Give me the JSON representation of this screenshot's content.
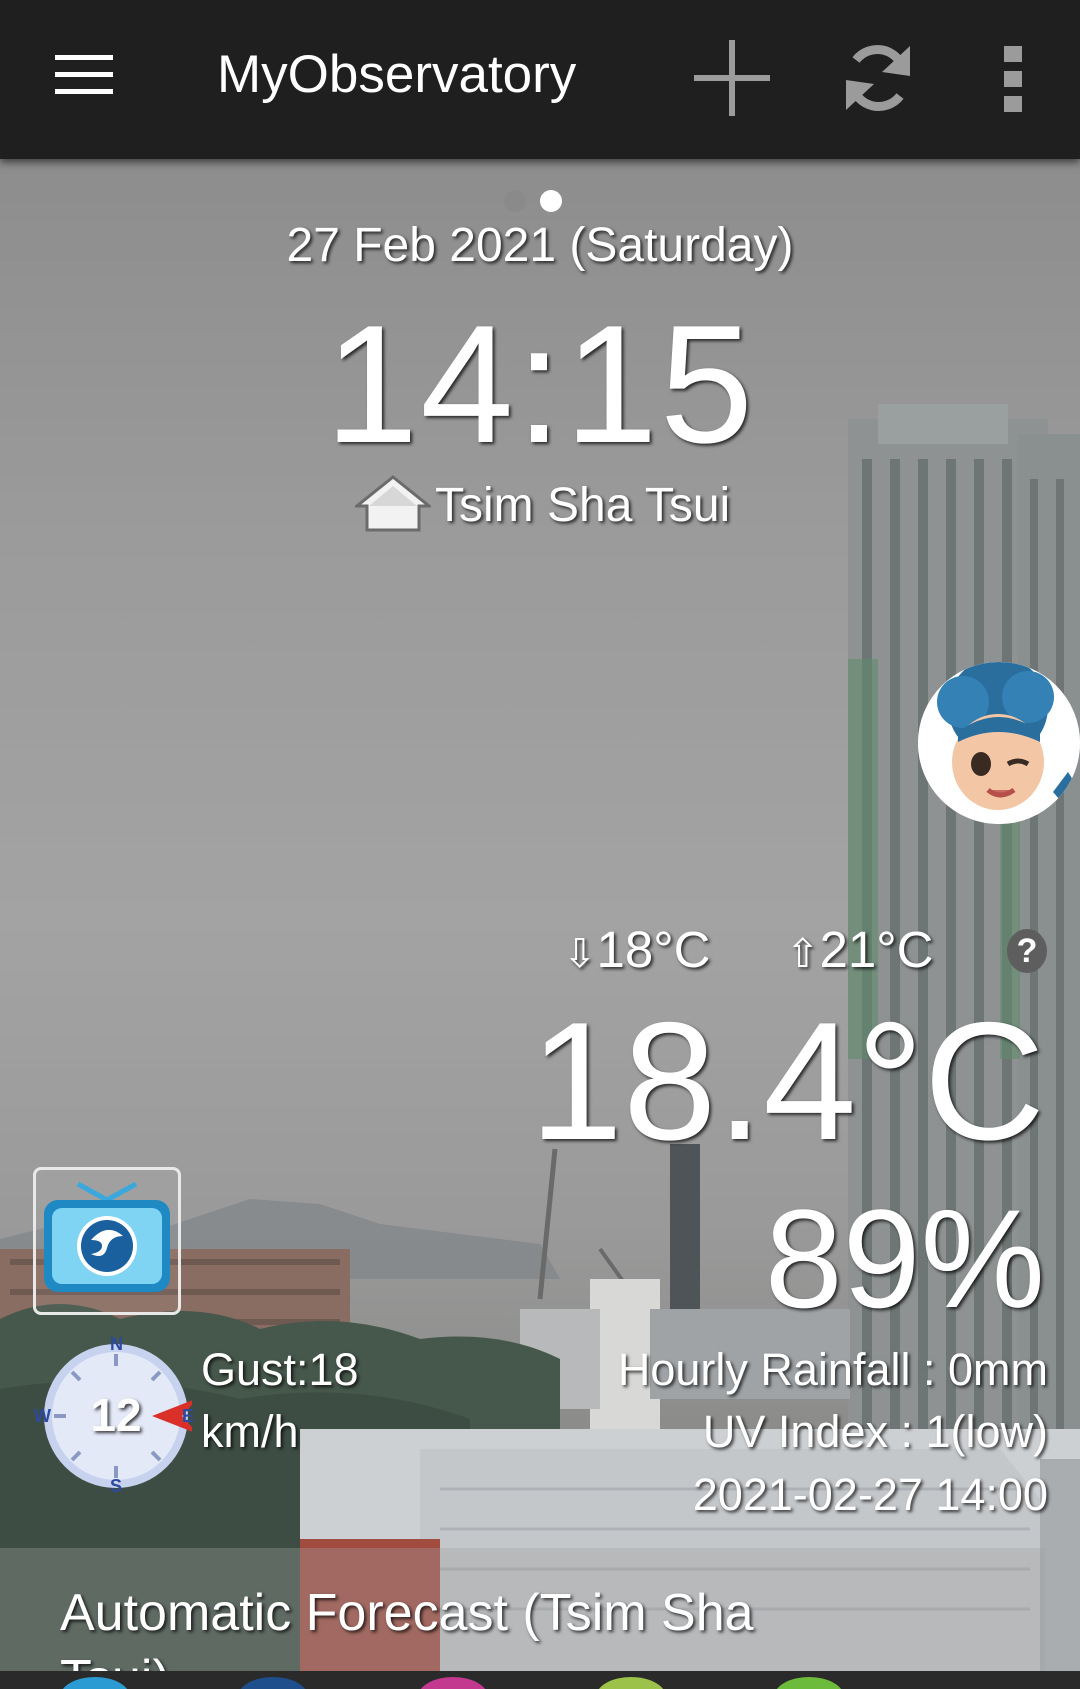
{
  "app_bar": {
    "title": "MyObservatory",
    "icons": [
      "menu-icon",
      "add-icon",
      "refresh-icon",
      "more-vert-icon"
    ]
  },
  "pager": {
    "page_count": 2,
    "active_index": 1
  },
  "header": {
    "date": "27 Feb 2021 (Saturday)",
    "time": "14:15",
    "location": "Tsim Sha Tsui",
    "location_icon": "home-icon"
  },
  "weather": {
    "min_temp": "18°C",
    "max_temp": "21°C",
    "help_label": "?",
    "current_temp": "18.4°C",
    "humidity": "89%",
    "hourly_rainfall": "Hourly Rainfall : 0mm",
    "uv_index": "UV Index : 1(low)",
    "observation_time": "2021-02-27 14:00"
  },
  "wind": {
    "speed": "12",
    "gust_line1": "Gust:18",
    "gust_line2": "km/h",
    "directions": {
      "n": "N",
      "e": "E",
      "s": "S",
      "w": "W"
    }
  },
  "forecast": {
    "title": "Automatic Forecast (Tsim Sha Tsui)"
  },
  "colors": {
    "app_bar": "#1f1f1f",
    "compass_face": "#dfe6f5",
    "compass_arrow": "#d9302a",
    "tv_screen": "#3aa8dc"
  }
}
